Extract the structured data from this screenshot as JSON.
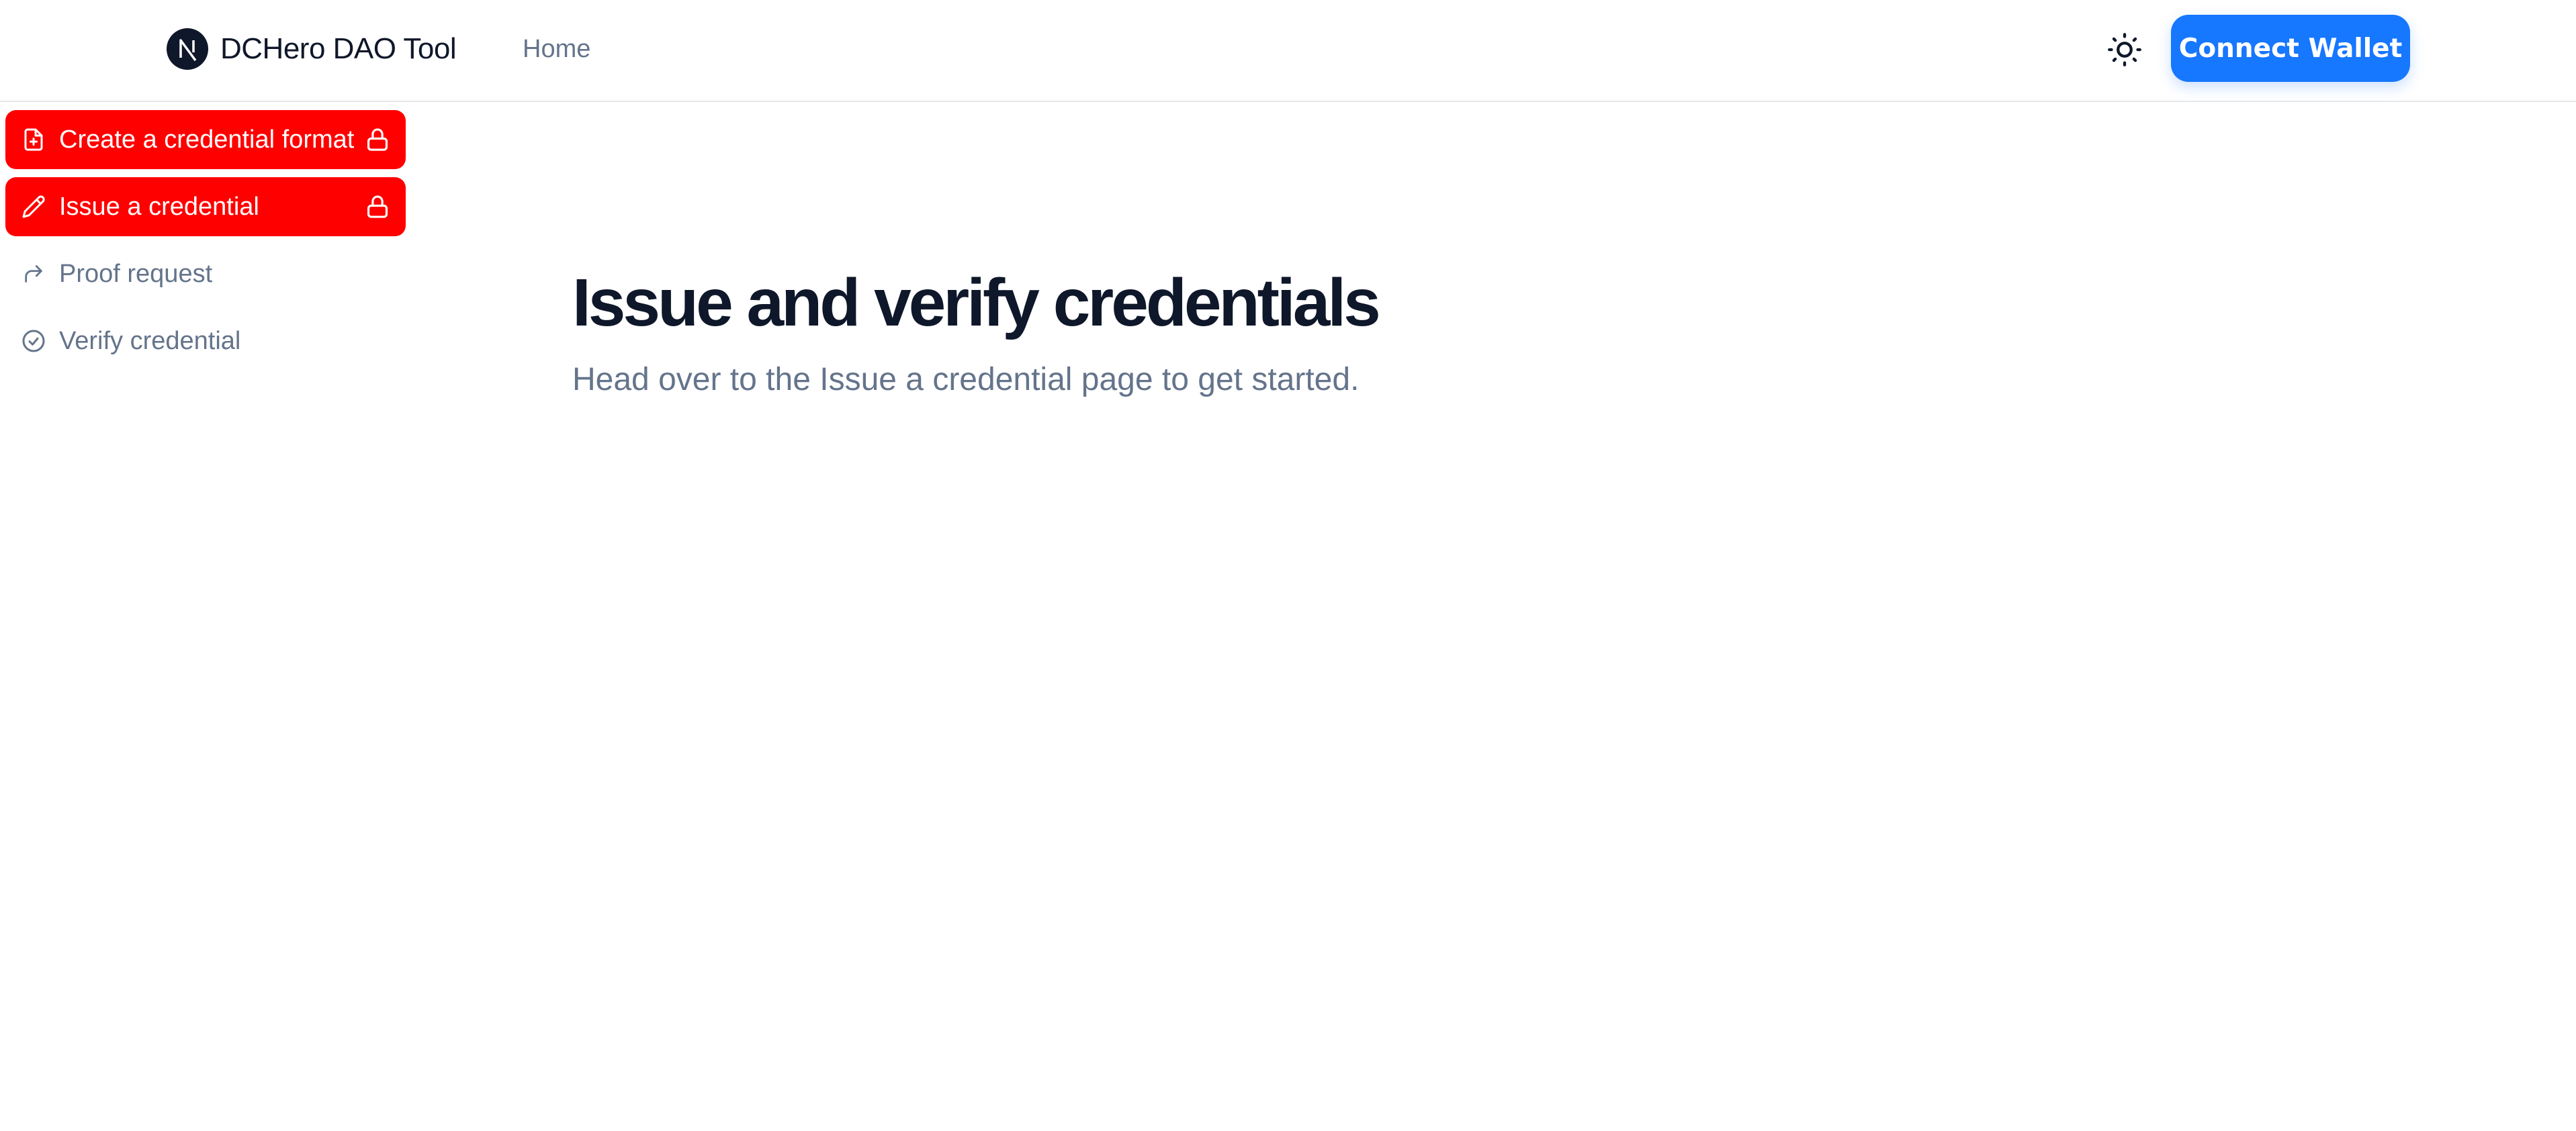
{
  "header": {
    "brand_name": "DCHero DAO Tool",
    "logo_icon": "nextjs-logo-icon",
    "nav": {
      "home_label": "Home"
    },
    "theme_icon": "sun-icon",
    "connect_wallet_label": "Connect Wallet"
  },
  "sidebar": {
    "items": [
      {
        "label": "Create a credential format",
        "icon": "file-plus-icon",
        "locked": true
      },
      {
        "label": "Issue a credential",
        "icon": "pencil-icon",
        "locked": true
      },
      {
        "label": "Proof request",
        "icon": "forward-arrow-icon",
        "locked": false
      },
      {
        "label": "Verify credential",
        "icon": "check-circle-icon",
        "locked": false
      }
    ]
  },
  "main": {
    "title": "Issue and verify credentials",
    "subtitle": "Head over to the Issue a credential page to get started."
  },
  "colors": {
    "locked_item_bg": "#ff0000",
    "primary_button": "#1677ff",
    "muted_text": "#64748b",
    "heading_text": "#0f172a"
  }
}
